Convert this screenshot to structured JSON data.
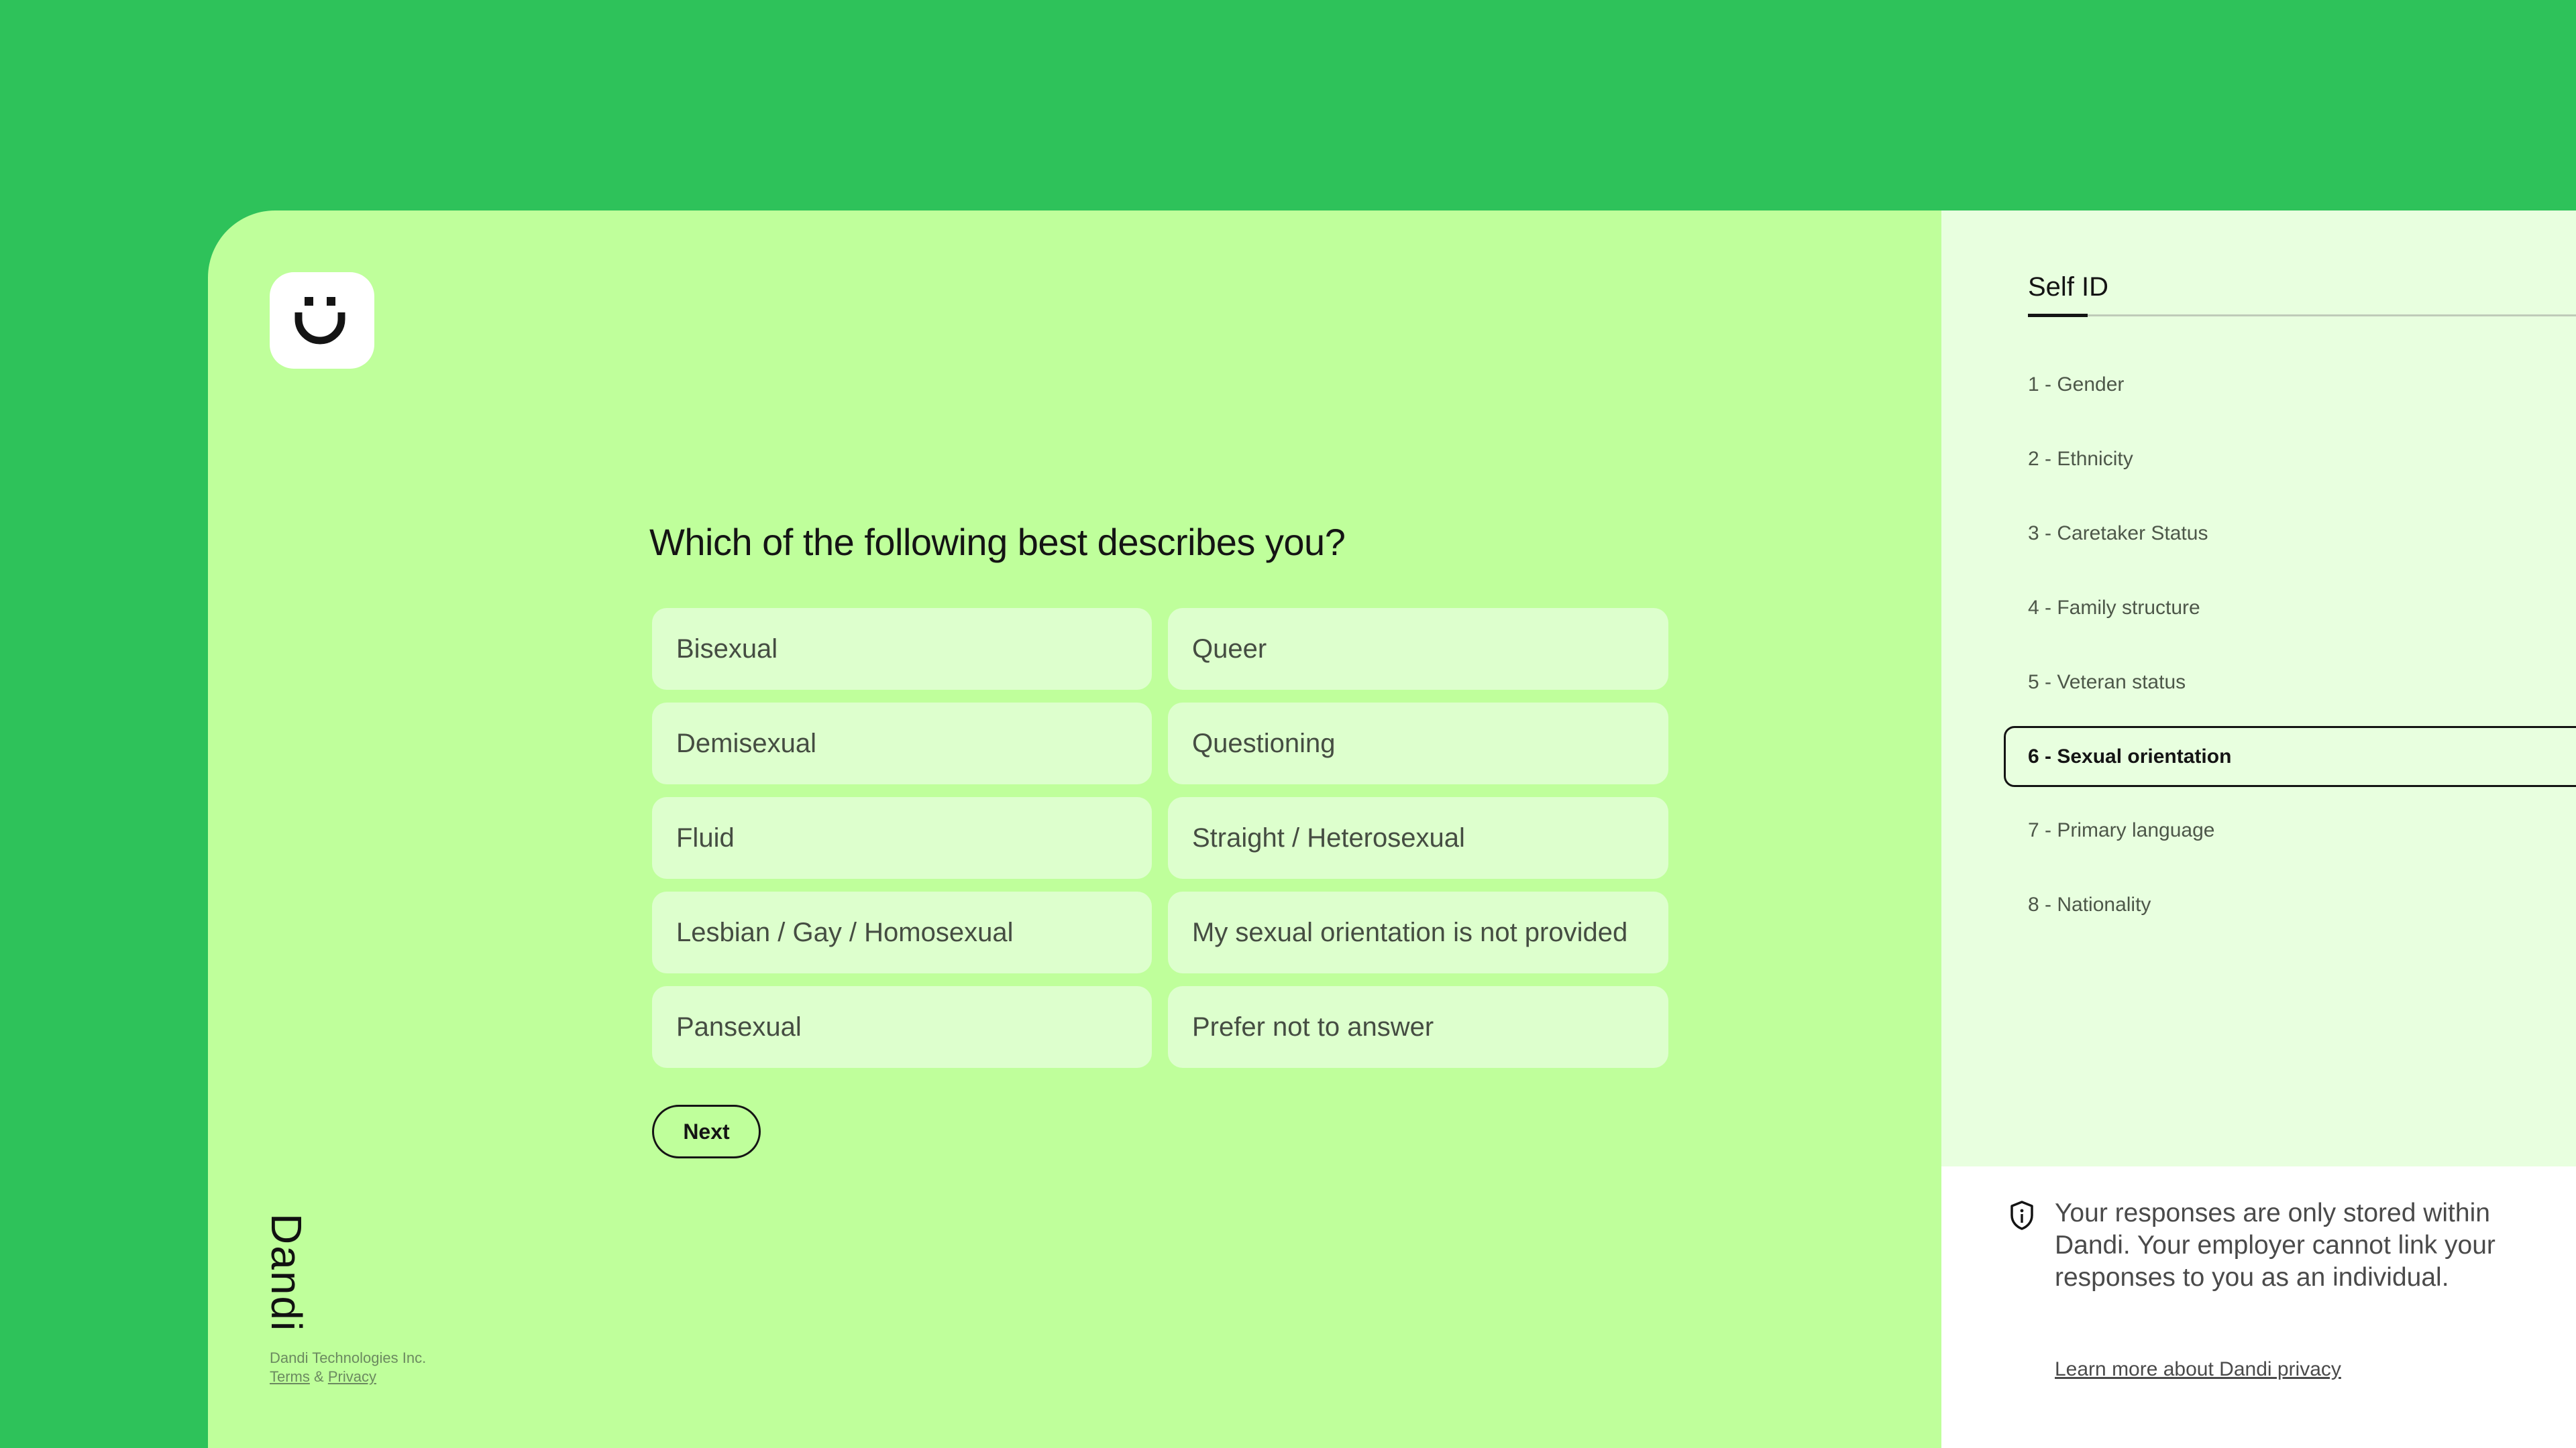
{
  "colors": {
    "background": "#2ec25a",
    "main_panel": "#bfff9b",
    "option_fill": "#ddffcd",
    "sidebar": "#e8ffdf",
    "privacy_panel": "#ffffff",
    "ink": "#141414"
  },
  "brand": {
    "logo_icon": "smiley-face-icon",
    "wordmark": "Dandi",
    "company": "Dandi Technologies Inc.",
    "terms_label": "Terms",
    "ampersand": "&",
    "privacy_label": "Privacy"
  },
  "question": {
    "title": "Which of the following best describes you?",
    "options": [
      "Bisexual",
      "Queer",
      "Demisexual",
      "Questioning",
      "Fluid",
      "Straight / Heterosexual",
      "Lesbian / Gay / Homosexual",
      "My sexual orientation is not provided",
      "Pansexual",
      "Prefer not to answer"
    ],
    "next_label": "Next"
  },
  "sidebar": {
    "title": "Self ID",
    "steps": [
      {
        "label": "1 - Gender",
        "active": false
      },
      {
        "label": "2 - Ethnicity",
        "active": false
      },
      {
        "label": "3 - Caretaker Status",
        "active": false
      },
      {
        "label": "4 - Family structure",
        "active": false
      },
      {
        "label": "5 - Veteran status",
        "active": false
      },
      {
        "label": "6 - Sexual orientation",
        "active": true
      },
      {
        "label": "7 - Primary language",
        "active": false
      },
      {
        "label": "8 - Nationality",
        "active": false
      }
    ]
  },
  "privacy": {
    "icon": "shield-info-icon",
    "message": "Your responses are only stored within Dandi. Your employer cannot link your responses to you as an individual.",
    "link_label": "Learn more about Dandi privacy"
  }
}
